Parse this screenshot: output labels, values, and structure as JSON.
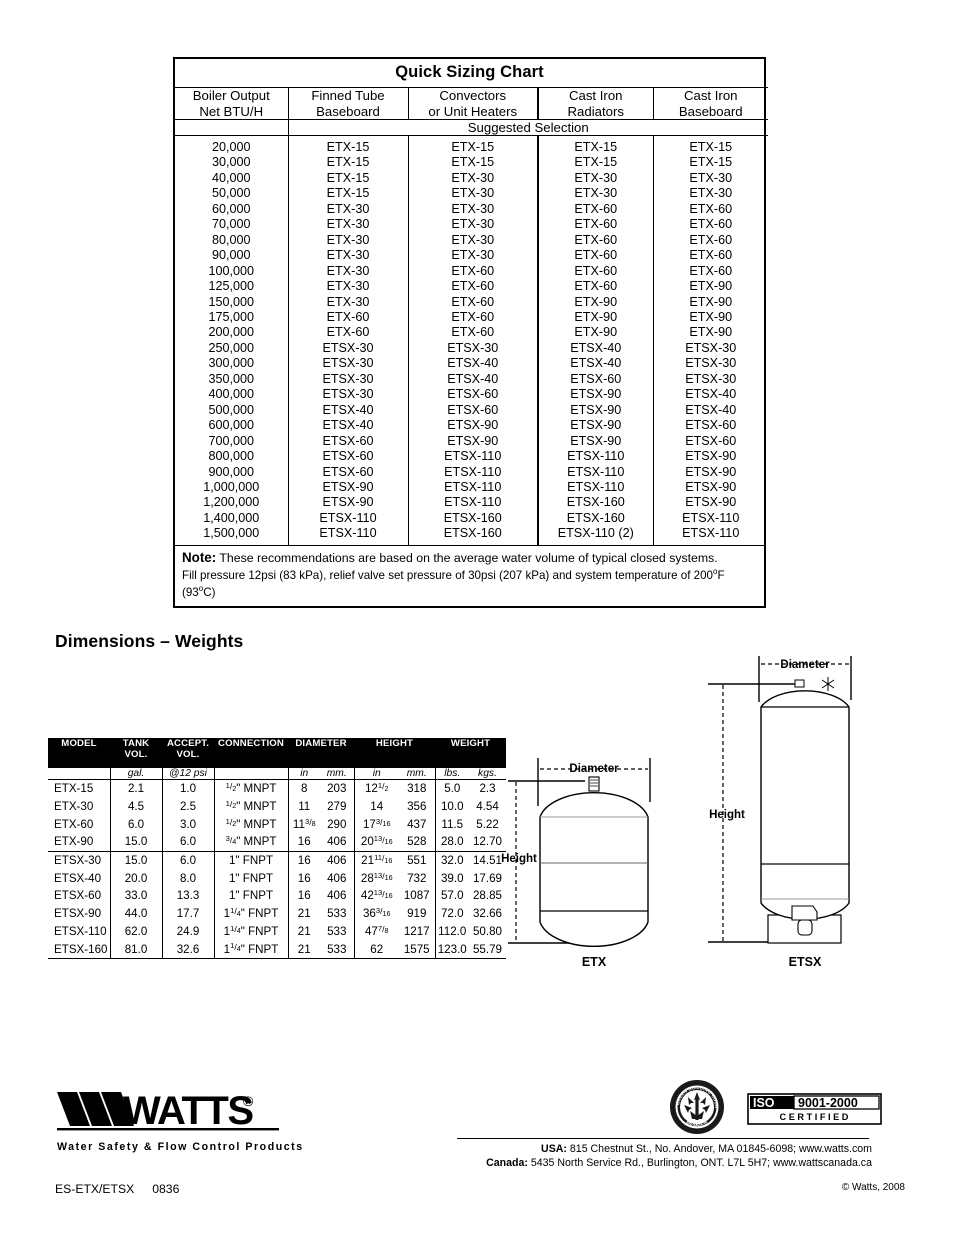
{
  "quick_sizing_chart": {
    "title": "Quick Sizing Chart",
    "columns": [
      {
        "line1": "Boiler Output",
        "line2": "Net BTU/H"
      },
      {
        "line1": "Finned Tube",
        "line2": "Baseboard"
      },
      {
        "line1": "Convectors",
        "line2": "or Unit Heaters"
      },
      {
        "line1": "Cast Iron",
        "line2": "Radiators"
      },
      {
        "line1": "Cast Iron",
        "line2": "Baseboard"
      }
    ],
    "spanner_label": "Suggested Selection",
    "rows": [
      {
        "btu": "20,000",
        "finned": "ETX-15",
        "convector": "ETX-15",
        "radiator": "ETX-15",
        "baseboard": "ETX-15"
      },
      {
        "btu": "30,000",
        "finned": "ETX-15",
        "convector": "ETX-15",
        "radiator": "ETX-15",
        "baseboard": "ETX-15"
      },
      {
        "btu": "40,000",
        "finned": "ETX-15",
        "convector": "ETX-30",
        "radiator": "ETX-30",
        "baseboard": "ETX-30"
      },
      {
        "btu": "50,000",
        "finned": "ETX-15",
        "convector": "ETX-30",
        "radiator": "ETX-30",
        "baseboard": "ETX-30"
      },
      {
        "btu": "60,000",
        "finned": "ETX-30",
        "convector": "ETX-30",
        "radiator": "ETX-60",
        "baseboard": "ETX-60"
      },
      {
        "btu": "70,000",
        "finned": "ETX-30",
        "convector": "ETX-30",
        "radiator": "ETX-60",
        "baseboard": "ETX-60"
      },
      {
        "btu": "80,000",
        "finned": "ETX-30",
        "convector": "ETX-30",
        "radiator": "ETX-60",
        "baseboard": "ETX-60"
      },
      {
        "btu": "90,000",
        "finned": "ETX-30",
        "convector": "ETX-30",
        "radiator": "ETX-60",
        "baseboard": "ETX-60"
      },
      {
        "btu": "100,000",
        "finned": "ETX-30",
        "convector": "ETX-60",
        "radiator": "ETX-60",
        "baseboard": "ETX-60"
      },
      {
        "btu": "125,000",
        "finned": "ETX-30",
        "convector": "ETX-60",
        "radiator": "ETX-60",
        "baseboard": "ETX-90"
      },
      {
        "btu": "150,000",
        "finned": "ETX-30",
        "convector": "ETX-60",
        "radiator": "ETX-90",
        "baseboard": "ETX-90"
      },
      {
        "btu": "175,000",
        "finned": "ETX-60",
        "convector": "ETX-60",
        "radiator": "ETX-90",
        "baseboard": "ETX-90"
      },
      {
        "btu": "200,000",
        "finned": "ETX-60",
        "convector": "ETX-60",
        "radiator": "ETX-90",
        "baseboard": "ETX-90"
      },
      {
        "btu": "250,000",
        "finned": "ETSX-30",
        "convector": "ETSX-30",
        "radiator": "ETSX-40",
        "baseboard": "ETSX-30"
      },
      {
        "btu": "300,000",
        "finned": "ETSX-30",
        "convector": "ETSX-40",
        "radiator": "ETSX-40",
        "baseboard": "ETSX-30"
      },
      {
        "btu": "350,000",
        "finned": "ETSX-30",
        "convector": "ETSX-40",
        "radiator": "ETSX-60",
        "baseboard": "ETSX-30"
      },
      {
        "btu": "400,000",
        "finned": "ETSX-30",
        "convector": "ETSX-60",
        "radiator": "ETSX-90",
        "baseboard": "ETSX-40"
      },
      {
        "btu": "500,000",
        "finned": "ETSX-40",
        "convector": "ETSX-60",
        "radiator": "ETSX-90",
        "baseboard": "ETSX-40"
      },
      {
        "btu": "600,000",
        "finned": "ETSX-40",
        "convector": "ETSX-90",
        "radiator": "ETSX-90",
        "baseboard": "ETSX-60"
      },
      {
        "btu": "700,000",
        "finned": "ETSX-60",
        "convector": "ETSX-90",
        "radiator": "ETSX-90",
        "baseboard": "ETSX-60"
      },
      {
        "btu": "800,000",
        "finned": "ETSX-60",
        "convector": "ETSX-110",
        "radiator": "ETSX-110",
        "baseboard": "ETSX-90"
      },
      {
        "btu": "900,000",
        "finned": "ETSX-60",
        "convector": "ETSX-110",
        "radiator": "ETSX-110",
        "baseboard": "ETSX-90"
      },
      {
        "btu": "1,000,000",
        "finned": "ETSX-90",
        "convector": "ETSX-110",
        "radiator": "ETSX-110",
        "baseboard": "ETSX-90"
      },
      {
        "btu": "1,200,000",
        "finned": "ETSX-90",
        "convector": "ETSX-110",
        "radiator": "ETSX-160",
        "baseboard": "ETSX-90"
      },
      {
        "btu": "1,400,000",
        "finned": "ETSX-110",
        "convector": "ETSX-160",
        "radiator": "ETSX-160",
        "baseboard": "ETSX-110"
      },
      {
        "btu": "1,500,000",
        "finned": "ETSX-110",
        "convector": "ETSX-160",
        "radiator": "ETSX-110 (2)",
        "baseboard": "ETSX-110"
      }
    ],
    "note_label": "Note:",
    "note_text": "These recommendations are based on the average water volume of typical closed systems.",
    "note_line2_a": "Fill pressure 12psi (83 kPa), relief valve set pressure of 30psi (207 kPa) and system temperature of 200",
    "note_line2_b": "F (93",
    "note_line2_c": "C)"
  },
  "dimensions": {
    "heading": "Dimensions – Weights",
    "headers": {
      "model": "MODEL",
      "tank_vol": "TANK VOL.",
      "accept_vol_1": "ACCEPT.",
      "accept_vol_2": "VOL.",
      "connection": "CONNECTION",
      "diameter": "DIAMETER",
      "height": "HEIGHT",
      "weight": "WEIGHT"
    },
    "units": {
      "model": "",
      "tank_vol": "gal.",
      "accept_vol": "@12 psi",
      "connection": "",
      "dia_in": "in",
      "dia_mm": "mm.",
      "h_in": "in",
      "h_mm": "mm.",
      "w_lbs": "lbs.",
      "w_kgs": "kgs."
    },
    "rows_etx": [
      {
        "model": "ETX-15",
        "tank_vol": "2.1",
        "accept_vol": "1.0",
        "connection": "MNPT",
        "conn_frac_n": "1",
        "conn_frac_d": "2",
        "dia_in": "8",
        "dia_in_frac_n": "",
        "dia_in_frac_d": "",
        "dia_mm": "203",
        "h_in": "12",
        "h_frac_n": "1",
        "h_frac_d": "2",
        "h_mm": "318",
        "w_lbs": "5.0",
        "w_kgs": "2.3"
      },
      {
        "model": "ETX-30",
        "tank_vol": "4.5",
        "accept_vol": "2.5",
        "connection": "MNPT",
        "conn_frac_n": "1",
        "conn_frac_d": "2",
        "dia_in": "11",
        "dia_in_frac_n": "",
        "dia_in_frac_d": "",
        "dia_mm": "279",
        "h_in": "14",
        "h_frac_n": "",
        "h_frac_d": "",
        "h_mm": "356",
        "w_lbs": "10.0",
        "w_kgs": "4.54"
      },
      {
        "model": "ETX-60",
        "tank_vol": "6.0",
        "accept_vol": "3.0",
        "connection": "MNPT",
        "conn_frac_n": "1",
        "conn_frac_d": "2",
        "dia_in": "11",
        "dia_in_frac_n": "3",
        "dia_in_frac_d": "8",
        "dia_mm": "290",
        "h_in": "17",
        "h_frac_n": "3",
        "h_frac_d": "16",
        "h_mm": "437",
        "w_lbs": "11.5",
        "w_kgs": "5.22"
      },
      {
        "model": "ETX-90",
        "tank_vol": "15.0",
        "accept_vol": "6.0",
        "connection": "MNPT",
        "conn_frac_n": "3",
        "conn_frac_d": "4",
        "dia_in": "16",
        "dia_in_frac_n": "",
        "dia_in_frac_d": "",
        "dia_mm": "406",
        "h_in": "20",
        "h_frac_n": "13",
        "h_frac_d": "16",
        "h_mm": "528",
        "w_lbs": "28.0",
        "w_kgs": "12.70"
      }
    ],
    "rows_etsx": [
      {
        "model": "ETSX-30",
        "tank_vol": "15.0",
        "accept_vol": "6.0",
        "connection": "FNPT",
        "conn_whole": "1",
        "conn_frac_n": "",
        "conn_frac_d": "",
        "dia_in": "16",
        "dia_mm": "406",
        "h_in": "21",
        "h_frac_n": "11",
        "h_frac_d": "16",
        "h_mm": "551",
        "w_lbs": "32.0",
        "w_kgs": "14.51"
      },
      {
        "model": "ETSX-40",
        "tank_vol": "20.0",
        "accept_vol": "8.0",
        "connection": "FNPT",
        "conn_whole": "1",
        "conn_frac_n": "",
        "conn_frac_d": "",
        "dia_in": "16",
        "dia_mm": "406",
        "h_in": "28",
        "h_frac_n": "13",
        "h_frac_d": "16",
        "h_mm": "732",
        "w_lbs": "39.0",
        "w_kgs": "17.69"
      },
      {
        "model": "ETSX-60",
        "tank_vol": "33.0",
        "accept_vol": "13.3",
        "connection": "FNPT",
        "conn_whole": "1",
        "conn_frac_n": "",
        "conn_frac_d": "",
        "dia_in": "16",
        "dia_mm": "406",
        "h_in": "42",
        "h_frac_n": "13",
        "h_frac_d": "16",
        "h_mm": "1087",
        "w_lbs": "57.0",
        "w_kgs": "28.85"
      },
      {
        "model": "ETSX-90",
        "tank_vol": "44.0",
        "accept_vol": "17.7",
        "connection": "FNPT",
        "conn_whole": "1",
        "conn_frac_n": "1",
        "conn_frac_d": "4",
        "dia_in": "21",
        "dia_mm": "533",
        "h_in": "36",
        "h_frac_n": "3",
        "h_frac_d": "16",
        "h_mm": "919",
        "w_lbs": "72.0",
        "w_kgs": "32.66"
      },
      {
        "model": "ETSX-110",
        "tank_vol": "62.0",
        "accept_vol": "24.9",
        "connection": "FNPT",
        "conn_whole": "1",
        "conn_frac_n": "1",
        "conn_frac_d": "4",
        "dia_in": "21",
        "dia_mm": "533",
        "h_in": "47",
        "h_frac_n": "7",
        "h_frac_d": "8",
        "h_mm": "1217",
        "w_lbs": "112.0",
        "w_kgs": "50.80"
      },
      {
        "model": "ETSX-160",
        "tank_vol": "81.0",
        "accept_vol": "32.6",
        "connection": "FNPT",
        "conn_whole": "1",
        "conn_frac_n": "1",
        "conn_frac_d": "4",
        "dia_in": "21",
        "dia_mm": "533",
        "h_in": "62",
        "h_frac_n": "",
        "h_frac_d": "",
        "h_mm": "1575",
        "w_lbs": "123.0",
        "w_kgs": "55.79"
      }
    ]
  },
  "diagrams": {
    "etx": {
      "label": "ETX",
      "diameter_label": "Diameter",
      "height_label": "Height"
    },
    "etsx": {
      "label": "ETSX",
      "diameter_label": "Diameter",
      "height_label": "Height"
    }
  },
  "footer": {
    "logo_text": "WATTS",
    "logo_registered": "®",
    "tagline": "Water Safety & Flow Control Products",
    "badge_green": {
      "top_text": "U.S. GREEN BUILDING COUNCIL",
      "bottom_text": "MEMBER"
    },
    "badge_iso": {
      "iso": "ISO",
      "standard": "9001-2000",
      "certified": "C E R T I F I E D"
    },
    "usa_label": "USA:",
    "usa_address": "815 Chestnut St., No. Andover, MA 01845-6098; www.watts.com",
    "canada_label": "Canada:",
    "canada_address": "5435 North Service Rd., Burlington, ONT. L7L 5H7; www.wattscanada.ca",
    "doc_code": "ES-ETX/ETSX",
    "doc_number": "0836",
    "copyright": "© Watts, 2008"
  }
}
